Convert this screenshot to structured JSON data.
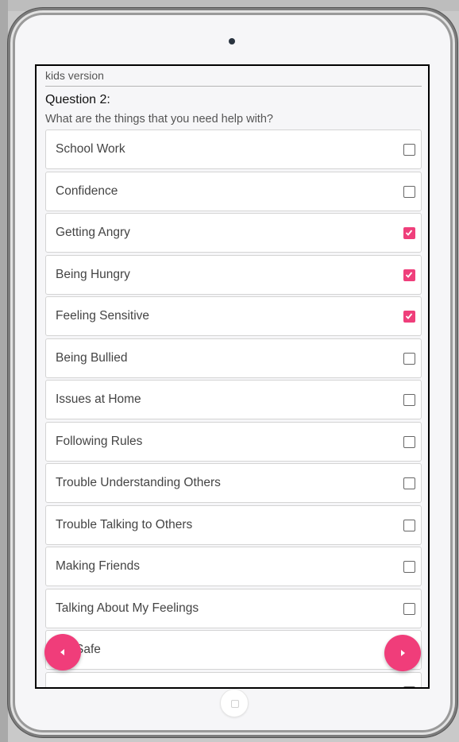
{
  "header": {
    "subtitle": "kids version"
  },
  "question": {
    "title": "Question 2:",
    "text": "What are the things that you need help with?"
  },
  "options": [
    {
      "label": "School Work",
      "checked": false
    },
    {
      "label": "Confidence",
      "checked": false
    },
    {
      "label": "Getting Angry",
      "checked": true
    },
    {
      "label": "Being Hungry",
      "checked": true
    },
    {
      "label": "Feeling Sensitive",
      "checked": true
    },
    {
      "label": "Being Bullied",
      "checked": false
    },
    {
      "label": "Issues at Home",
      "checked": false
    },
    {
      "label": "Following Rules",
      "checked": false
    },
    {
      "label": "Trouble Understanding Others",
      "checked": false
    },
    {
      "label": "Trouble Talking to Others",
      "checked": false
    },
    {
      "label": "Making Friends",
      "checked": false
    },
    {
      "label": "Talking About My Feelings",
      "checked": false
    },
    {
      "label": "ing Safe",
      "checked": false
    },
    {
      "label": "",
      "checked": false
    }
  ],
  "navigation": {
    "prev_icon": "triangle-left-icon",
    "next_icon": "triangle-right-icon"
  },
  "colors": {
    "accent": "#f03d7a",
    "checkbox_checked": "#ef3f7b"
  }
}
